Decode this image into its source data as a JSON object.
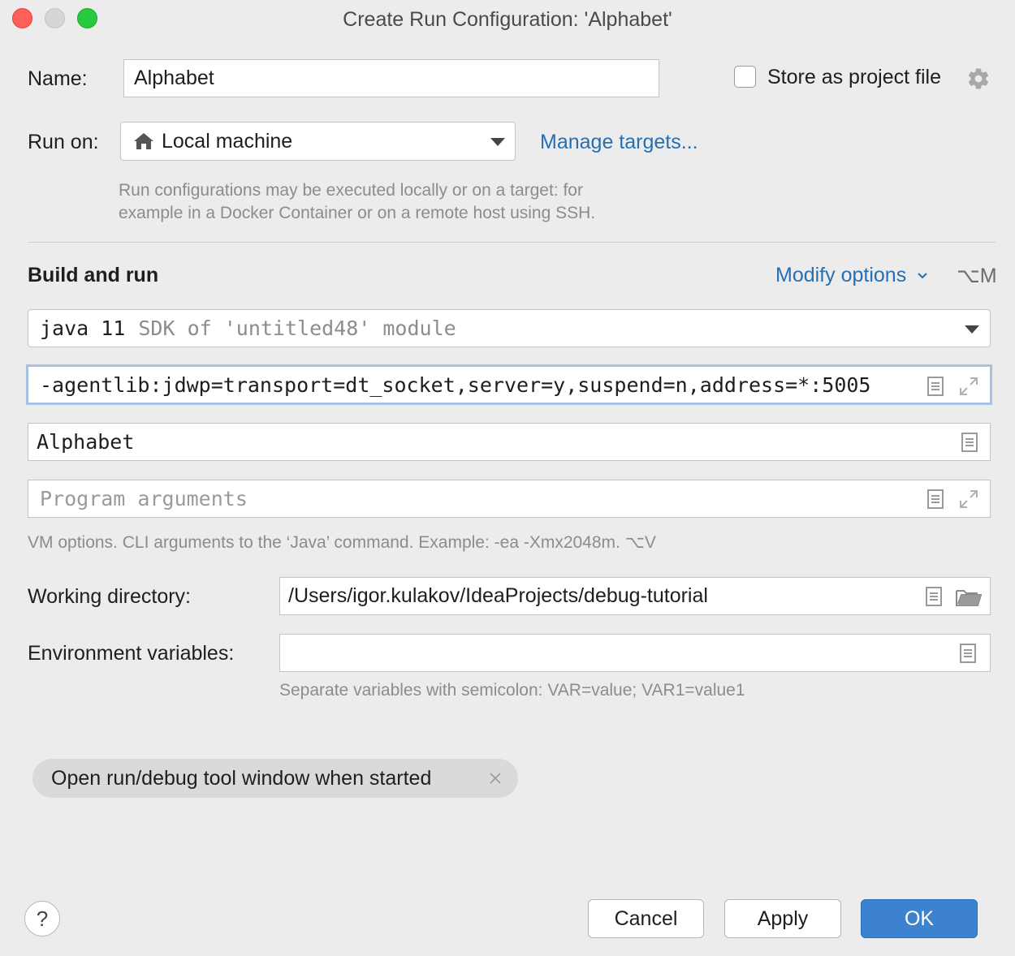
{
  "window": {
    "title": "Create Run Configuration: 'Alphabet'"
  },
  "name": {
    "label": "Name:",
    "value": "Alphabet",
    "store_label": "Store as project file",
    "store_checked": false
  },
  "run_on": {
    "label": "Run on:",
    "value": "Local machine",
    "manage_link": "Manage targets...",
    "hint_line1": "Run configurations may be executed locally or on a target: for",
    "hint_line2": "example in a Docker Container or on a remote host using SSH."
  },
  "build_and_run": {
    "heading": "Build and run",
    "modify_options": "Modify options",
    "modify_shortcut": "⌥M",
    "jre": {
      "value": "java 11",
      "hint": "SDK of 'untitled48' module"
    },
    "vm_options": "-agentlib:jdwp=transport=dt_socket,server=y,suspend=n,address=*:5005",
    "main_class": "Alphabet",
    "program_args_placeholder": "Program arguments",
    "vm_hint": "VM options. CLI arguments to the ‘Java’ command. Example: -ea -Xmx2048m. ⌥V"
  },
  "working_directory": {
    "label": "Working directory:",
    "value": "/Users/igor.kulakov/IdeaProjects/debug-tutorial"
  },
  "environment": {
    "label": "Environment variables:",
    "value": "",
    "hint": "Separate variables with semicolon: VAR=value; VAR1=value1"
  },
  "chip": {
    "label": "Open run/debug tool window when started"
  },
  "buttons": {
    "help": "?",
    "cancel": "Cancel",
    "apply": "Apply",
    "ok": "OK"
  },
  "colors": {
    "link": "#2470b3",
    "primary_button": "#3d82cf",
    "focus_ring": "#a6c3e6"
  }
}
